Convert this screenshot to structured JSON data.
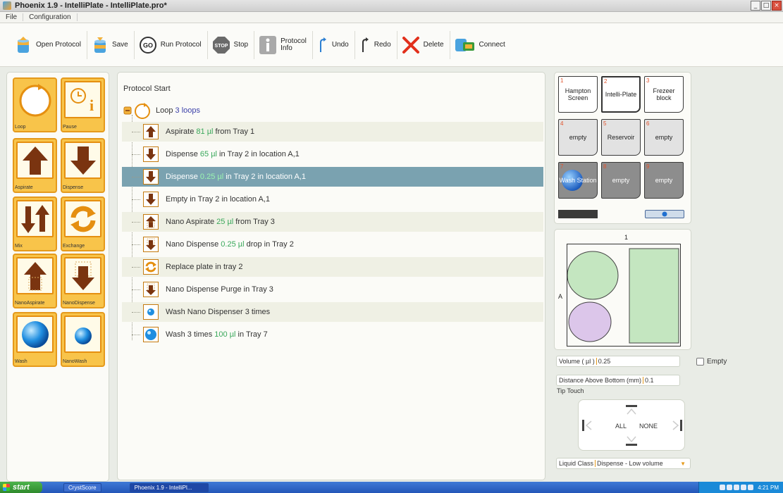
{
  "window": {
    "title": "Phoenix 1.9 - IntelliPlate  - IntelliPlate.pro*"
  },
  "menu": {
    "items": [
      "File",
      "Configuration"
    ]
  },
  "toolbar": {
    "open": "Open Protocol",
    "save": "Save",
    "run": "Run Protocol",
    "stop": "Stop",
    "stop_icon_text": "STOP",
    "run_icon_text": "GO",
    "info": "Protocol\nInfo",
    "undo": "Undo",
    "redo": "Redo",
    "delete": "Delete",
    "connect": "Connect"
  },
  "palette": {
    "items": [
      {
        "label": "Loop",
        "icon": "loop-icon"
      },
      {
        "label": "Pause",
        "icon": "pause-clock-icon"
      },
      {
        "label": "Aspirate",
        "icon": "arrow-up-icon"
      },
      {
        "label": "Dispense",
        "icon": "arrow-down-icon"
      },
      {
        "label": "Mix",
        "icon": "mix-arrows-icon"
      },
      {
        "label": "Exchange",
        "icon": "exchange-icon"
      },
      {
        "label": "NanoAspirate",
        "icon": "nano-aspirate-icon"
      },
      {
        "label": "NanoDispense",
        "icon": "nano-dispense-icon"
      },
      {
        "label": "Wash",
        "icon": "wash-sphere-icon"
      },
      {
        "label": "NanoWash",
        "icon": "nanowash-sphere-icon"
      }
    ]
  },
  "protocol": {
    "start_label": "Protocol Start",
    "loop": {
      "prefix": "Loop ",
      "count": "3 loops"
    },
    "steps": [
      {
        "icon": "up",
        "pre": "Aspirate ",
        "val": "81 µl",
        "post": " from Tray 1"
      },
      {
        "icon": "down",
        "pre": "Dispense ",
        "val": "65 µl",
        "post": " in Tray 2 in location A,1"
      },
      {
        "icon": "down",
        "pre": "Dispense ",
        "val": "0.25 µl",
        "post": " in Tray 2 in location A,1",
        "selected": true
      },
      {
        "icon": "down",
        "pre": "Empty in Tray 2 in location A,1",
        "val": "",
        "post": ""
      },
      {
        "icon": "nanoup",
        "pre": "Nano Aspirate ",
        "val": "25 µl",
        "post": "  from Tray 3"
      },
      {
        "icon": "nanodown",
        "pre": "Nano Dispense ",
        "val": "0.25 µl",
        "post": "  drop   in Tray 2"
      },
      {
        "icon": "exchange",
        "pre": "Replace plate in tray 2",
        "val": "",
        "post": ""
      },
      {
        "icon": "nanodown",
        "pre": "Nano Dispense Purge   in Tray 3",
        "val": "",
        "post": ""
      },
      {
        "icon": "nanowash",
        "pre": "Wash Nano Dispenser 3 times",
        "val": "",
        "post": ""
      },
      {
        "icon": "wash",
        "pre": "Wash  3 times ",
        "val": "100 µl",
        "post": "  in Tray 7"
      }
    ]
  },
  "trays": [
    {
      "num": "1",
      "label": "Hampton Screen",
      "style": "light"
    },
    {
      "num": "2",
      "label": "Intelli-Plate",
      "style": "light",
      "selected": true
    },
    {
      "num": "3",
      "label": "Frezeer block",
      "style": "light"
    },
    {
      "num": "4",
      "label": "empty",
      "style": "mid"
    },
    {
      "num": "5",
      "label": "Reservoir",
      "style": "mid"
    },
    {
      "num": "6",
      "label": "empty",
      "style": "mid"
    },
    {
      "num": "7",
      "label": "Wash Station",
      "style": "dark"
    },
    {
      "num": "8",
      "label": "empty",
      "style": "dark"
    },
    {
      "num": "9",
      "label": "empty",
      "style": "dark"
    }
  ],
  "plate": {
    "col_label": "1",
    "row_label": "A"
  },
  "form": {
    "volume_label": "Volume ( µl )",
    "volume_value": "0.25",
    "empty_label": "Empty",
    "distance_label": "Distance Above Bottom (mm)",
    "distance_value": "0.1",
    "tip_touch_label": "Tip Touch",
    "tip_all": "ALL",
    "tip_none": "NONE",
    "liquid_class_label": "Liquid Class",
    "liquid_class_value": "Dispense - Low volume"
  },
  "taskbar": {
    "start": "start",
    "items": [
      "CrystScore",
      "Phoenix 1.9 - IntelliPl..."
    ],
    "clock": "4:21 PM"
  },
  "colors": {
    "accent_orange": "#e59a1c",
    "tile_fill": "#f8c44a",
    "value_green": "#3aa85b",
    "selected_row": "#7aa2b0",
    "loop_count": "#3a3fa8"
  }
}
